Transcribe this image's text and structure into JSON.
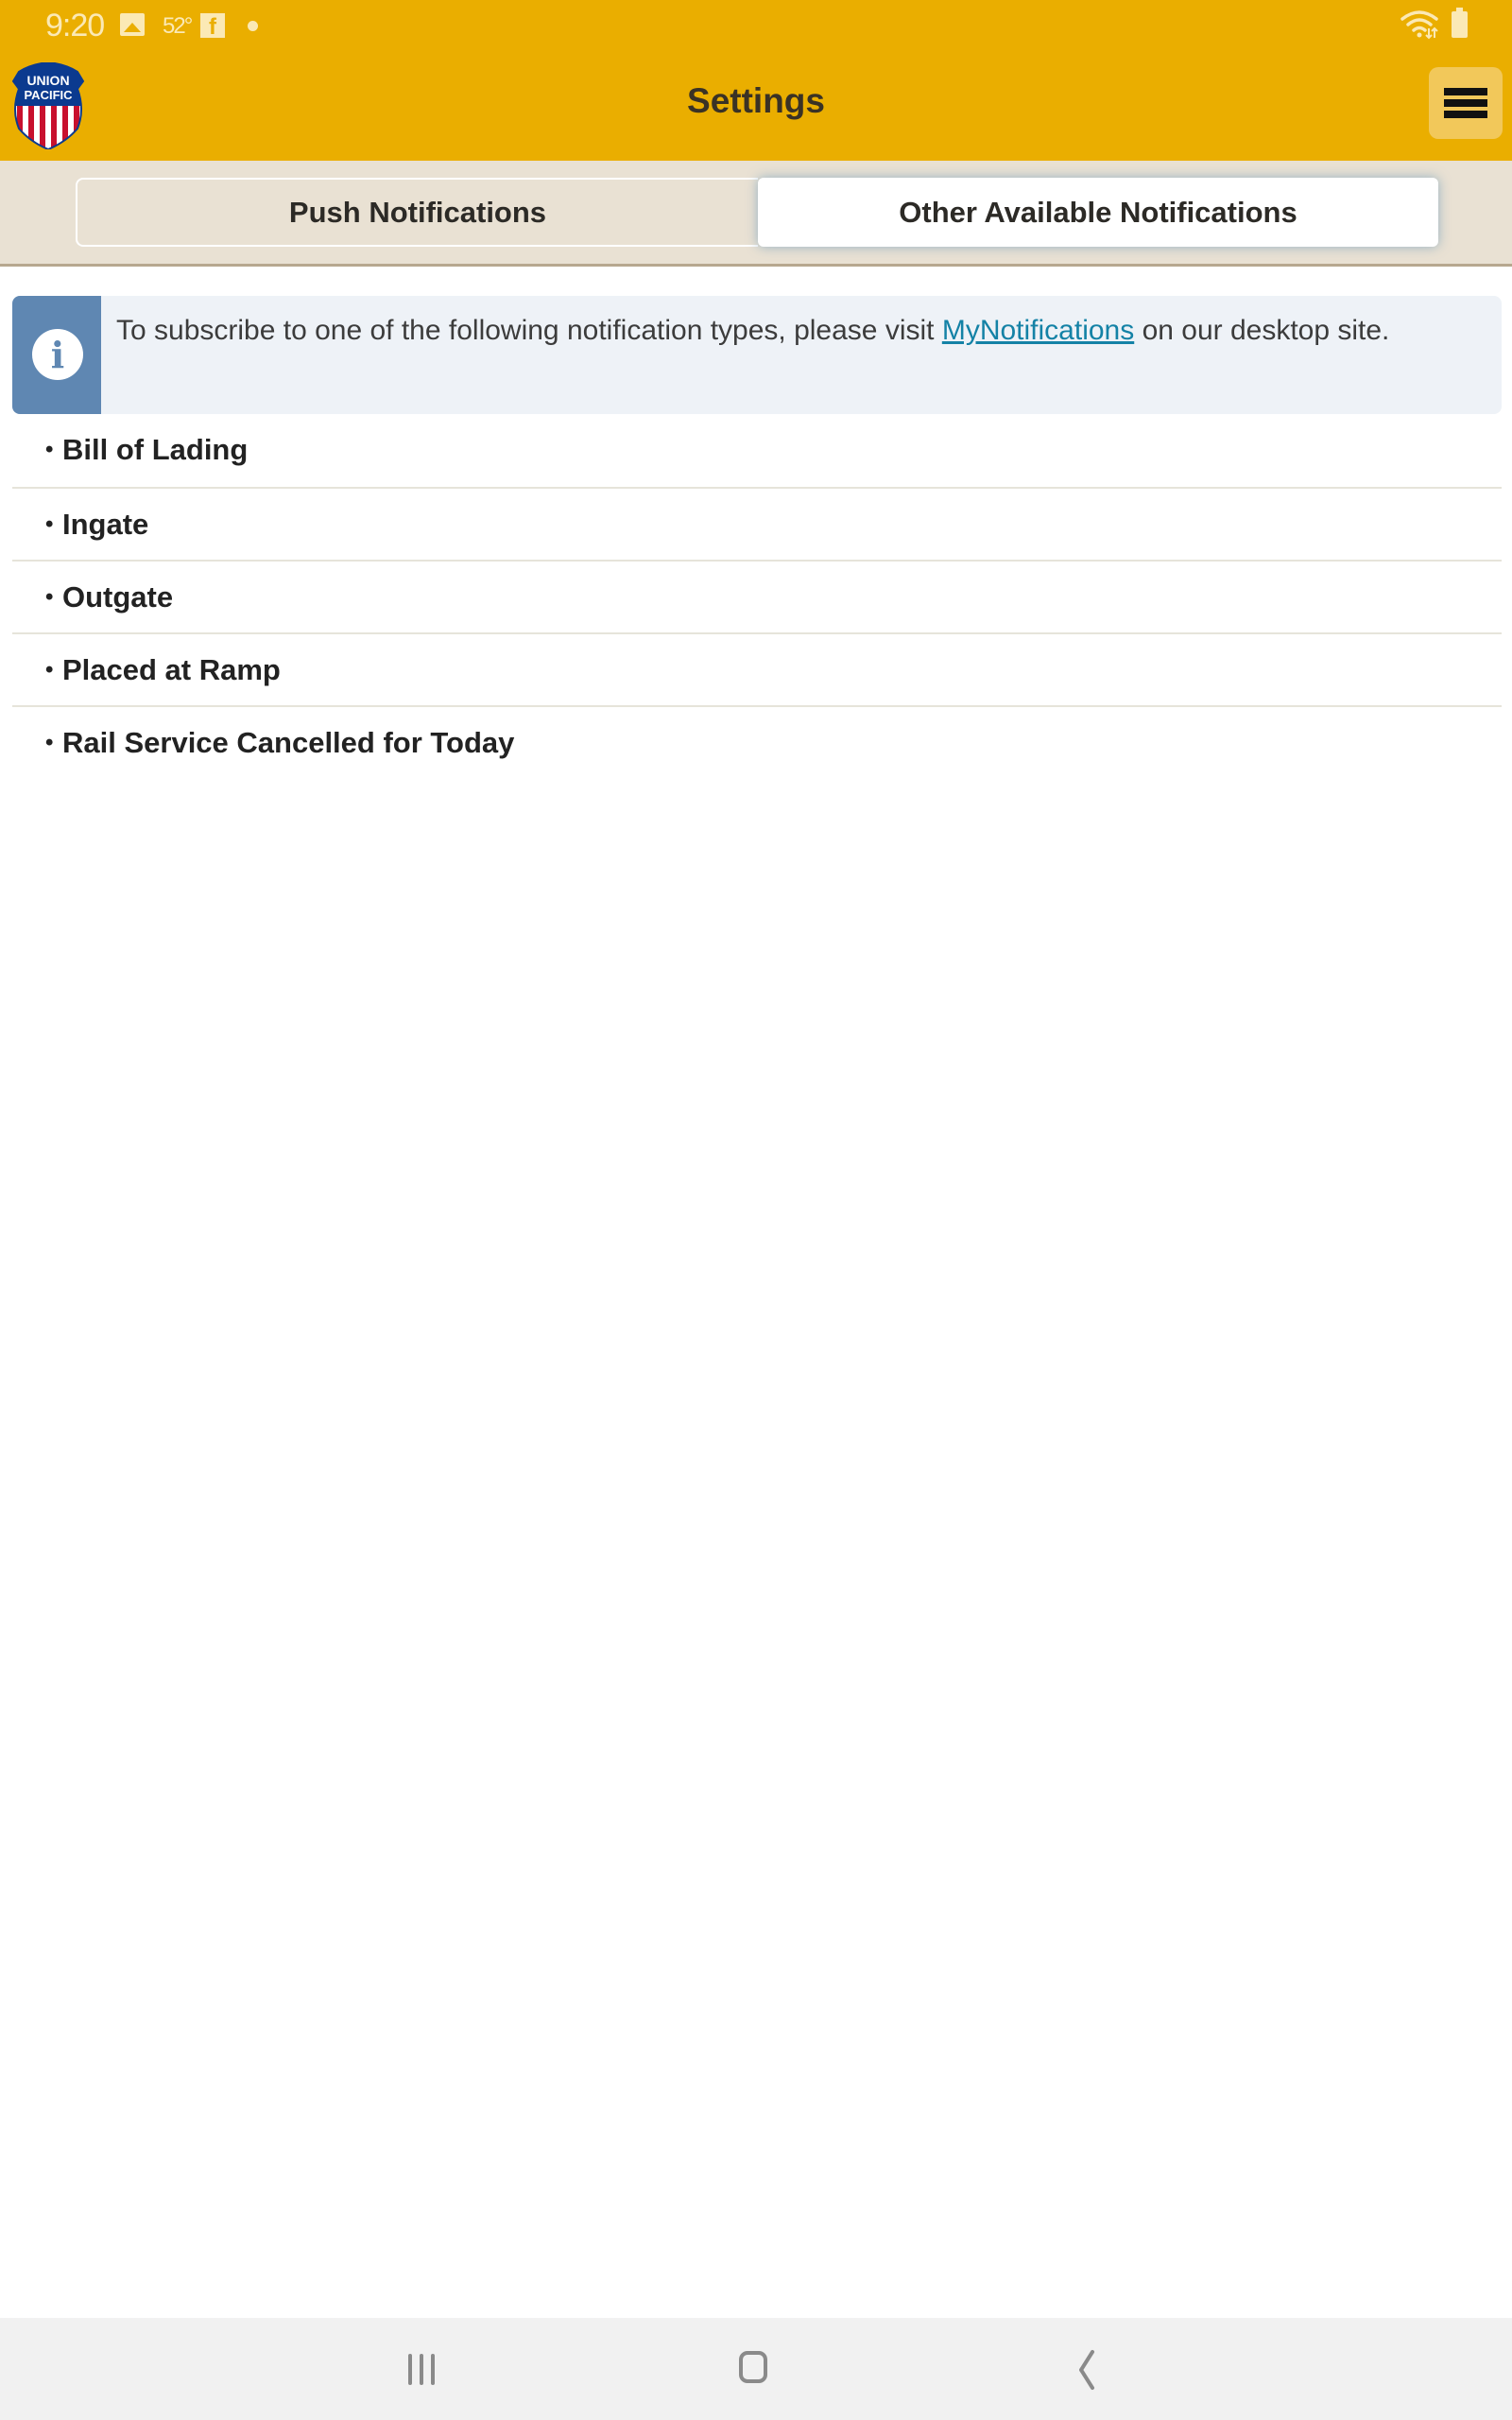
{
  "status_bar": {
    "time": "9:20",
    "temperature": "52°",
    "icons": [
      "gallery-icon",
      "weather-temp",
      "facebook-icon",
      "notification-dot-icon",
      "wifi-icon",
      "battery-icon"
    ],
    "facebook_glyph": "f"
  },
  "header": {
    "title": "Settings",
    "logo_line1": "UNION",
    "logo_line2": "PACIFIC",
    "menu_icon": "hamburger-menu-icon"
  },
  "tabs": [
    {
      "label": "Push Notifications",
      "selected": false
    },
    {
      "label": "Other Available Notifications",
      "selected": true
    }
  ],
  "info": {
    "icon": "info-icon",
    "icon_glyph": "i",
    "text_before": "To subscribe to one of the following notification types, please visit ",
    "link_text": "MyNotifications",
    "text_after": " on our desktop site."
  },
  "notification_types": [
    "Bill of Lading",
    "Ingate",
    "Outgate",
    "Placed at Ramp",
    "Rail Service Cancelled for Today"
  ],
  "bullet": "•",
  "nav_bar": {
    "buttons": [
      "recents",
      "home",
      "back"
    ]
  },
  "colors": {
    "brand_yellow": "#eaae00",
    "tab_bar_bg": "#e9e1d3",
    "info_accent": "#5f87b2",
    "link": "#1482a6"
  }
}
